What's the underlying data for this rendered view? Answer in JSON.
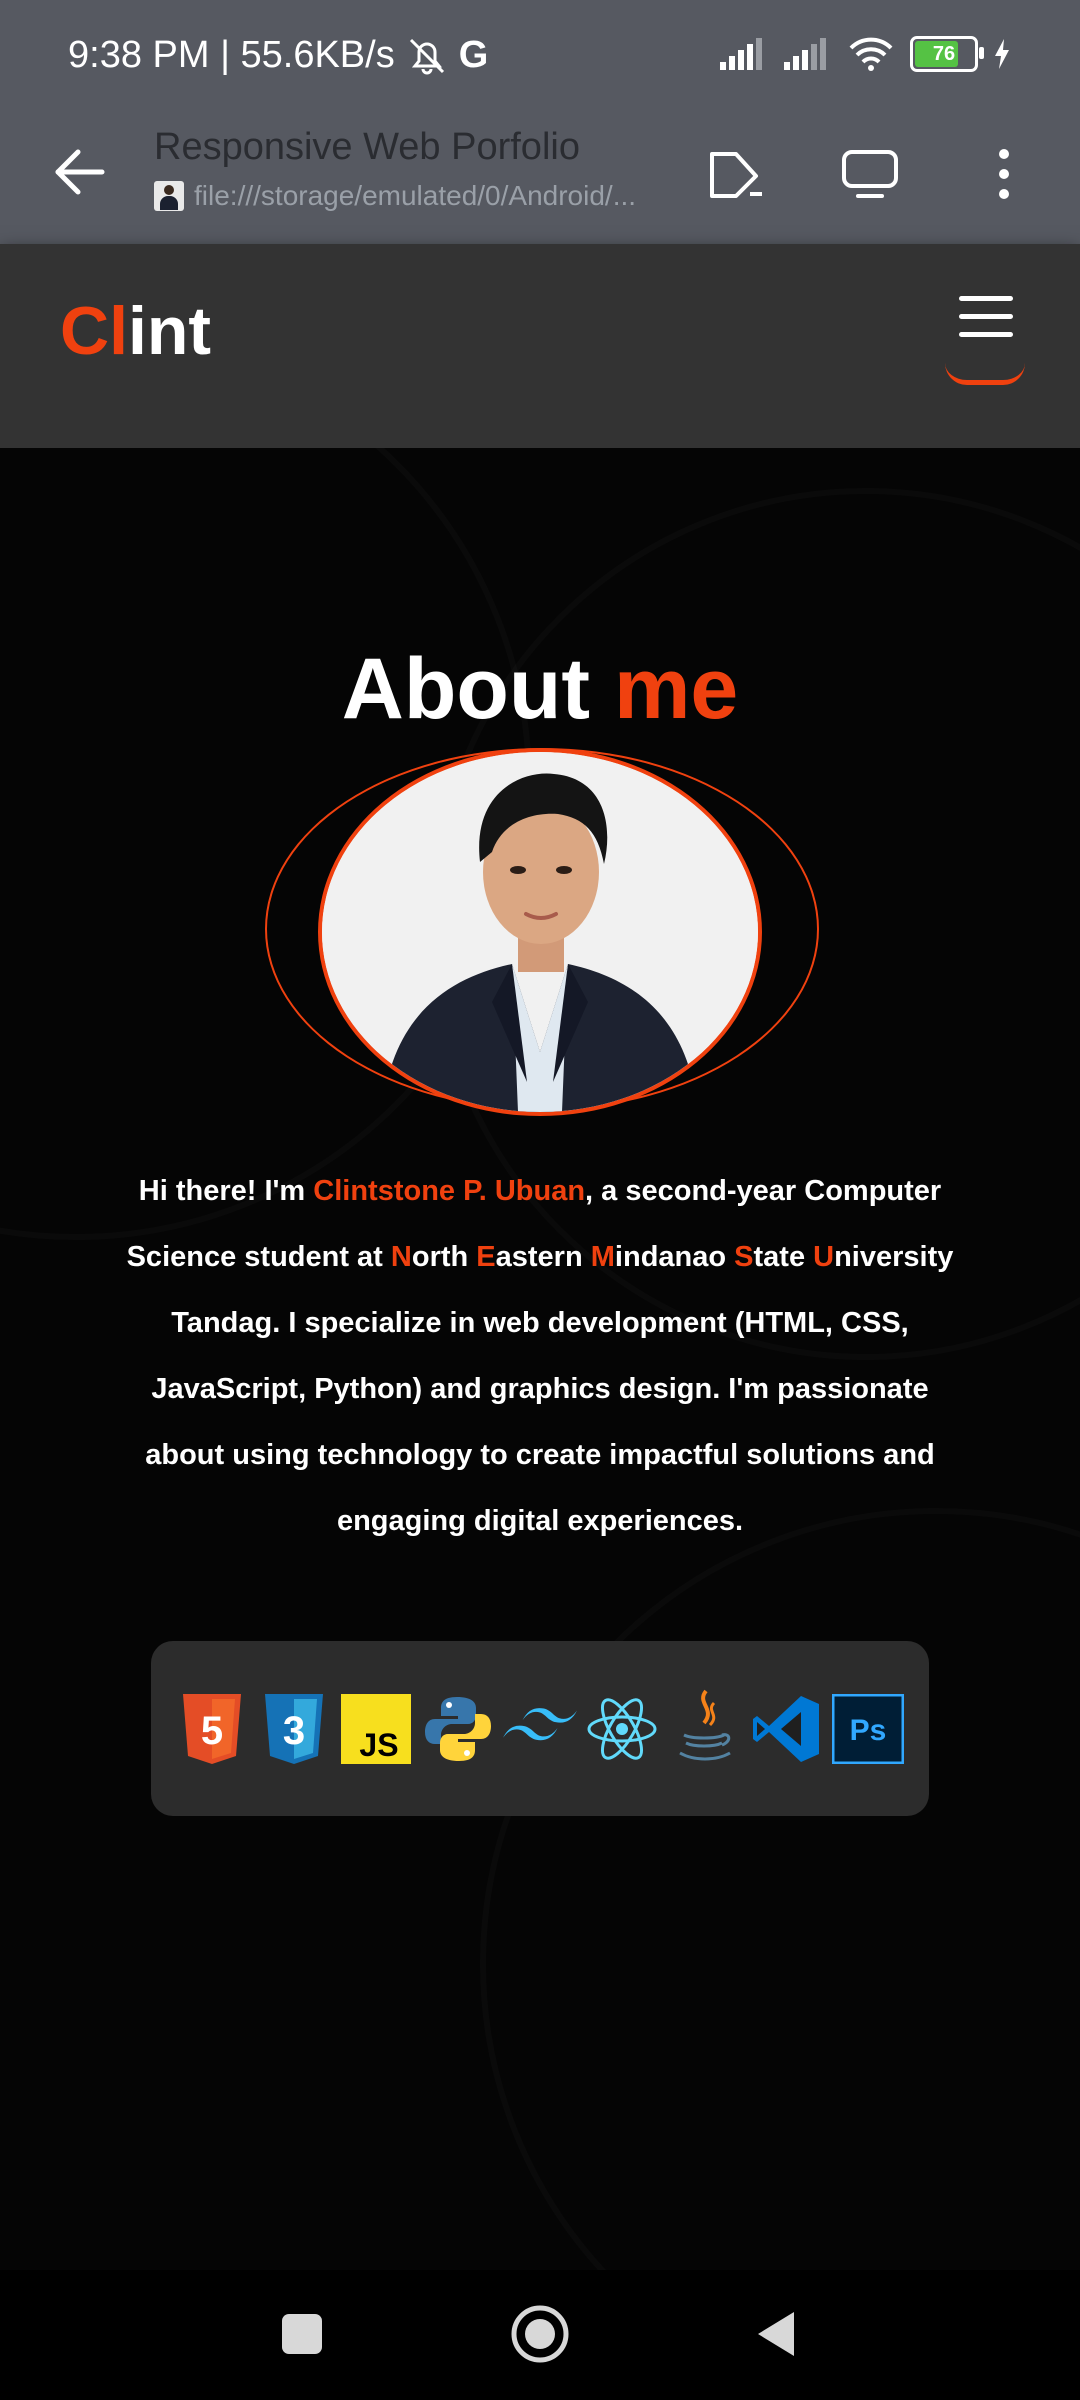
{
  "status_bar": {
    "time_speed": "9:38 PM | 55.6KB/s",
    "carrier_icon": "G",
    "battery_level": "76",
    "icons": [
      "mute-bell-icon",
      "google-icon",
      "signal-icon",
      "signal-icon",
      "wifi-icon",
      "battery-icon",
      "charging-icon"
    ]
  },
  "browser": {
    "page_title": "Responsive Web Porfolio",
    "url": "file:///storage/emulated/0/Android/..."
  },
  "site": {
    "logo_accent": "Cl",
    "logo_rest": "int",
    "heading_main": "About",
    "heading_accent": "me",
    "bio": {
      "p1": "Hi there! I'm ",
      "name": "Clintstone P. Ubuan",
      "p2": ", a second-year Computer Science student at ",
      "n": "N",
      "orth": "orth ",
      "e": "E",
      "astern": "astern ",
      "m": "M",
      "indanao": "indanao ",
      "s": "S",
      "tate": "tate ",
      "u": "U",
      "niversity": "niversity",
      "p3": " Tandag. I specialize in web development (HTML, CSS, JavaScript, Python) and graphics design. I'm passionate about using technology to create impactful solutions and engaging digital experiences."
    },
    "skills": {
      "html": "5",
      "css": "3",
      "js": "JS",
      "ps": "Ps"
    }
  },
  "colors": {
    "accent": "#f0410f",
    "bar": "#565961",
    "nav": "#333333",
    "card": "#2c2c2c"
  }
}
